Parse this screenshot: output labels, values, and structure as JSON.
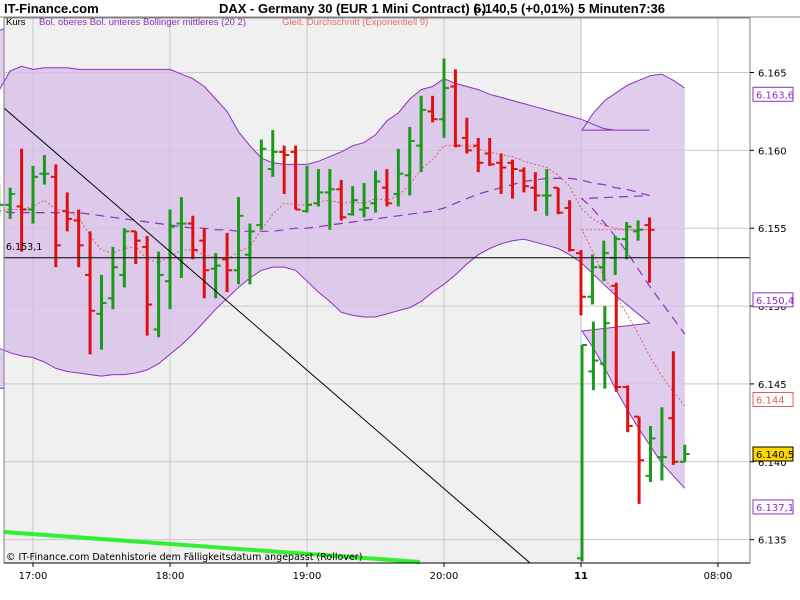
{
  "header": {
    "brand": "IT-Finance.com",
    "instrument": "DAX - Germany 30 (EUR 1 Mini Contract) (-)",
    "last": "6.140,5 (+0,01%)",
    "interval": "5 Minuten",
    "time": "7:36"
  },
  "legend": {
    "bollinger": "Bol. oberes Bol. unteres Bollinger mittleres (20 2)",
    "ema": "Gleit. Durchschnitt (Exponentiell 9)"
  },
  "kurs_label": "Kurs",
  "hline_label": "6.153,1",
  "footer_note": "© IT-Finance.com  Datenhistorie dem Fälligkeitsdatum angepasst (Rollover)",
  "colors": {
    "up": "#1a9a1a",
    "down": "#e01010",
    "band_fill": "#d8bfe8",
    "band_line": "#8e2fbe",
    "ema": "#e06060",
    "future_bg": "#ffffff",
    "plot_bg": "#f0f0f0",
    "green_line": "#33ee33"
  },
  "chart_data": {
    "type": "ohlc",
    "x_tick_labels": [
      "17:00",
      "18:00",
      "19:00",
      "20:00",
      "11",
      "08:00"
    ],
    "y_tick_labels": [
      "6.135",
      "6.140",
      "6.145",
      "6.150",
      "6.155",
      "6.160",
      "6.165"
    ],
    "ylim": [
      6133.5,
      6168.5
    ],
    "price_labels": [
      "6.163,6",
      "6.150,4",
      "6.144",
      "6.140,5",
      "6.137,1"
    ],
    "hline": 6153.1,
    "bars": [
      {
        "t": "16:35",
        "o": 6155.2,
        "h": 6158.9,
        "l": 6151.4,
        "c": 6157.1
      },
      {
        "t": "16:40",
        "o": 6157.1,
        "h": 6158.6,
        "l": 6155.9,
        "c": 6156.2
      },
      {
        "t": "16:45",
        "o": 6156.2,
        "h": 6157.8,
        "l": 6155.8,
        "c": 6156.5
      },
      {
        "t": "16:50",
        "o": 6156.5,
        "h": 6157.6,
        "l": 6155.6,
        "c": 6157.2
      },
      {
        "t": "16:55",
        "o": 6156.4,
        "h": 6160.1,
        "l": 6153.5,
        "c": 6156.2
      },
      {
        "t": "17:00",
        "o": 6156.2,
        "h": 6159.0,
        "l": 6155.3,
        "c": 6158.3
      },
      {
        "t": "17:05",
        "o": 6158.5,
        "h": 6159.7,
        "l": 6157.8,
        "c": 6158.5
      },
      {
        "t": "17:10",
        "o": 6158.3,
        "h": 6159.1,
        "l": 6152.5,
        "c": 6153.9
      },
      {
        "t": "17:15",
        "o": 6156.1,
        "h": 6157.3,
        "l": 6154.8,
        "c": 6155.6
      },
      {
        "t": "17:20",
        "o": 6155.5,
        "h": 6156.2,
        "l": 6152.5,
        "c": 6153.9
      },
      {
        "t": "17:25",
        "o": 6152.0,
        "h": 6154.8,
        "l": 6146.9,
        "c": 6149.7
      },
      {
        "t": "17:30",
        "o": 6149.5,
        "h": 6152.0,
        "l": 6147.2,
        "c": 6150.2
      },
      {
        "t": "17:35",
        "o": 6150.5,
        "h": 6153.8,
        "l": 6149.8,
        "c": 6152.5
      },
      {
        "t": "17:40",
        "o": 6152.0,
        "h": 6155.0,
        "l": 6151.2,
        "c": 6154.8
      },
      {
        "t": "17:45",
        "o": 6154.8,
        "h": 6154.8,
        "l": 6152.7,
        "c": 6154.2
      },
      {
        "t": "17:50",
        "o": 6153.8,
        "h": 6154.5,
        "l": 6148.1,
        "c": 6150.1
      },
      {
        "t": "17:55",
        "o": 6148.5,
        "h": 6153.5,
        "l": 6148.0,
        "c": 6152.0
      },
      {
        "t": "18:00",
        "o": 6151.6,
        "h": 6156.2,
        "l": 6149.8,
        "c": 6155.1
      },
      {
        "t": "18:05",
        "o": 6155.3,
        "h": 6157.0,
        "l": 6151.8,
        "c": 6155.3
      },
      {
        "t": "18:10",
        "o": 6155.3,
        "h": 6155.8,
        "l": 6153.0,
        "c": 6153.6
      },
      {
        "t": "18:15",
        "o": 6154.2,
        "h": 6155.0,
        "l": 6150.5,
        "c": 6152.3
      },
      {
        "t": "18:20",
        "o": 6152.4,
        "h": 6153.4,
        "l": 6150.5,
        "c": 6152.6
      },
      {
        "t": "18:25",
        "o": 6153.0,
        "h": 6154.7,
        "l": 6150.9,
        "c": 6152.3
      },
      {
        "t": "18:30",
        "o": 6152.3,
        "h": 6157.0,
        "l": 6151.4,
        "c": 6155.8
      },
      {
        "t": "18:35",
        "o": 6153.3,
        "h": 6155.3,
        "l": 6151.4,
        "c": 6154.8
      },
      {
        "t": "18:40",
        "o": 6155.2,
        "h": 6160.7,
        "l": 6154.9,
        "c": 6160.1
      },
      {
        "t": "18:45",
        "o": 6158.8,
        "h": 6161.3,
        "l": 6158.3,
        "c": 6159.9
      },
      {
        "t": "18:50",
        "o": 6159.9,
        "h": 6160.3,
        "l": 6157.2,
        "c": 6159.7
      },
      {
        "t": "18:55",
        "o": 6159.9,
        "h": 6160.3,
        "l": 6156.2,
        "c": 6156.2
      },
      {
        "t": "19:00",
        "o": 6156.1,
        "h": 6159.0,
        "l": 6156.0,
        "c": 6156.5
      },
      {
        "t": "19:05",
        "o": 6156.6,
        "h": 6158.8,
        "l": 6156.4,
        "c": 6157.3
      },
      {
        "t": "19:10",
        "o": 6157.3,
        "h": 6158.8,
        "l": 6154.9,
        "c": 6157.5
      },
      {
        "t": "19:15",
        "o": 6157.5,
        "h": 6158.1,
        "l": 6155.5,
        "c": 6155.7
      },
      {
        "t": "19:20",
        "o": 6155.9,
        "h": 6157.7,
        "l": 6155.8,
        "c": 6156.8
      },
      {
        "t": "19:25",
        "o": 6156.2,
        "h": 6157.9,
        "l": 6155.7,
        "c": 6156.3
      },
      {
        "t": "19:30",
        "o": 6156.6,
        "h": 6158.7,
        "l": 6156.0,
        "c": 6158.0
      },
      {
        "t": "19:35",
        "o": 6157.6,
        "h": 6158.8,
        "l": 6156.4,
        "c": 6156.6
      },
      {
        "t": "19:40",
        "o": 6157.2,
        "h": 6160.1,
        "l": 6156.4,
        "c": 6158.5
      },
      {
        "t": "19:45",
        "o": 6158.4,
        "h": 6161.5,
        "l": 6157.1,
        "c": 6160.6
      },
      {
        "t": "19:50",
        "o": 6160.3,
        "h": 6163.5,
        "l": 6158.6,
        "c": 6162.6
      },
      {
        "t": "19:55",
        "o": 6162.5,
        "h": 6163.5,
        "l": 6161.8,
        "c": 6162.0
      },
      {
        "t": "20:00",
        "o": 6162.0,
        "h": 6165.9,
        "l": 6160.8,
        "c": 6164.0
      },
      {
        "t": "20:05",
        "o": 6164.1,
        "h": 6165.2,
        "l": 6160.2,
        "c": 6160.3
      },
      {
        "t": "20:10",
        "o": 6160.8,
        "h": 6162.1,
        "l": 6159.8,
        "c": 6160.0
      },
      {
        "t": "20:15",
        "o": 6160.3,
        "h": 6160.8,
        "l": 6158.6,
        "c": 6159.2
      },
      {
        "t": "20:20",
        "o": 6159.8,
        "h": 6160.8,
        "l": 6159.0,
        "c": 6159.1
      },
      {
        "t": "20:25",
        "o": 6159.2,
        "h": 6159.8,
        "l": 6157.2,
        "c": 6158.9
      },
      {
        "t": "20:30",
        "o": 6159.2,
        "h": 6159.4,
        "l": 6156.9,
        "c": 6158.8
      },
      {
        "t": "20:35",
        "o": 6158.7,
        "h": 6158.9,
        "l": 6157.3,
        "c": 6157.7
      },
      {
        "t": "20:40",
        "o": 6157.6,
        "h": 6158.6,
        "l": 6156.1,
        "c": 6157.1
      },
      {
        "t": "20:45",
        "o": 6157.1,
        "h": 6158.8,
        "l": 6155.8,
        "c": 6157.1
      },
      {
        "t": "20:50",
        "o": 6157.6,
        "h": 6157.6,
        "l": 6155.9,
        "c": 6156.0
      },
      {
        "t": "20:55",
        "o": 6156.3,
        "h": 6156.8,
        "l": 6153.5,
        "c": 6153.6
      },
      {
        "t": "21:00",
        "o": 6153.4,
        "h": 6153.6,
        "l": 6149.4,
        "c": 6150.6
      },
      {
        "t": "21:05",
        "o": 6150.6,
        "h": 6153.3,
        "l": 6150.1,
        "c": 6152.5
      },
      {
        "t": "21:10",
        "o": 6152.5,
        "h": 6154.2,
        "l": 6151.6,
        "c": 6153.4
      },
      {
        "t": "21:15",
        "o": 6153.1,
        "h": 6154.5,
        "l": 6152.0,
        "c": 6154.3
      },
      {
        "t": "21:20",
        "o": 6154.3,
        "h": 6155.4,
        "l": 6153.0,
        "c": 6155.1
      },
      {
        "t": "21:25",
        "o": 6154.8,
        "h": 6155.5,
        "l": 6154.2,
        "c": 6154.9
      },
      {
        "t": "21:30",
        "o": 6155.2,
        "h": 6155.7,
        "l": 6151.5,
        "c": 6154.9
      },
      {
        "t": "08:00",
        "o": 6133.8,
        "h": 6147.5,
        "l": 6133.6,
        "c": 6147.5
      },
      {
        "t": "08:05",
        "o": 6145.8,
        "h": 6149.0,
        "l": 6144.6,
        "c": 6146.5
      },
      {
        "t": "08:10",
        "o": 6146.3,
        "h": 6150.0,
        "l": 6144.7,
        "c": 6148.9
      },
      {
        "t": "08:15",
        "o": 6151.3,
        "h": 6151.5,
        "l": 6144.5,
        "c": 6144.8
      },
      {
        "t": "08:20",
        "o": 6144.8,
        "h": 6144.9,
        "l": 6141.9,
        "c": 6142.3
      },
      {
        "t": "08:25",
        "o": 6142.9,
        "h": 6142.9,
        "l": 6137.3,
        "c": 6140.1
      },
      {
        "t": "08:30",
        "o": 6139.1,
        "h": 6142.3,
        "l": 6138.7,
        "c": 6141.5
      },
      {
        "t": "08:35",
        "o": 6140.3,
        "h": 6143.5,
        "l": 6138.8,
        "c": 6140.3
      },
      {
        "t": "08:40",
        "o": 6142.8,
        "h": 6147.1,
        "l": 6139.8,
        "c": 6140.0
      },
      {
        "t": "08:45",
        "o": 6140.0,
        "h": 6141.1,
        "l": 6140.0,
        "c": 6140.5
      }
    ],
    "bollinger": {
      "upper": [
        6167.3,
        6165.2,
        6163.8,
        6165.1,
        6165.4,
        6165.2,
        6165.3,
        6165.3,
        6165.3,
        6165.2,
        6165.2,
        6165.2,
        6165.2,
        6165.2,
        6165.2,
        6165.2,
        6165.2,
        6165.2,
        6164.9,
        6164.6,
        6164.1,
        6163.3,
        6162.5,
        6161.2,
        6160.3,
        6159.5,
        6159.2,
        6159.1,
        6159.1,
        6159.1,
        6159.3,
        6159.6,
        6159.9,
        6160.3,
        6160.5,
        6161.0,
        6161.9,
        6162.4,
        6163.3,
        6163.9,
        6164.1,
        6164.6,
        6164.3,
        6164.1,
        6163.9,
        6163.6,
        6163.4,
        6163.2,
        6163.0,
        6162.8,
        6162.6,
        6162.4,
        6162.2,
        6162.0,
        6161.7,
        6161.4,
        6161.3,
        6161.3,
        6161.3,
        6161.3,
        6161.3,
        6162.4,
        6163.2,
        6163.7,
        6164.2,
        6164.5,
        6164.8,
        6164.9,
        6164.5,
        6164.0,
        6163.6,
        6163.6
      ],
      "lower": [
        6145.0,
        6145.8,
        6147.3,
        6147.0,
        6146.8,
        6146.7,
        6146.4,
        6146.0,
        6145.8,
        6145.7,
        6145.6,
        6145.5,
        6145.6,
        6145.6,
        6145.7,
        6145.9,
        6146.3,
        6146.9,
        6147.5,
        6148.2,
        6149.0,
        6149.8,
        6150.5,
        6151.2,
        6151.8,
        6152.3,
        6152.5,
        6152.5,
        6152.3,
        6151.6,
        6150.9,
        6150.3,
        6149.6,
        6149.4,
        6149.3,
        6149.3,
        6149.5,
        6149.7,
        6149.9,
        6150.3,
        6150.9,
        6151.4,
        6152.0,
        6152.7,
        6153.3,
        6153.7,
        6154.0,
        6154.2,
        6154.3,
        6154.1,
        6153.9,
        6153.7,
        6153.3,
        6152.8,
        6152.1,
        6151.4,
        6150.7,
        6150.1,
        6149.5,
        6148.9,
        6148.4,
        6147.3,
        6146.0,
        6144.6,
        6143.3,
        6142.1,
        6141.0,
        6139.9,
        6139.1,
        6138.3,
        6137.6,
        6137.1
      ],
      "middle": [
        6156.2,
        6156.1,
        6156.1,
        6156.0,
        6156.0,
        6156.0,
        6156.0,
        6156.0,
        6156.0,
        6156.0,
        6155.9,
        6155.8,
        6155.7,
        6155.6,
        6155.5,
        6155.4,
        6155.3,
        6155.2,
        6155.1,
        6155.0,
        6155.0,
        6154.9,
        6154.9,
        6154.8,
        6154.8,
        6154.8,
        6154.8,
        6154.9,
        6155.0,
        6155.0,
        6155.1,
        6155.2,
        6155.3,
        6155.4,
        6155.5,
        6155.6,
        6155.7,
        6155.8,
        6155.9,
        6156.0,
        6156.1,
        6156.3,
        6156.6,
        6156.9,
        6157.2,
        6157.4,
        6157.6,
        6157.8,
        6158.0,
        6158.1,
        6158.2,
        6158.2,
        6158.2,
        6158.1,
        6157.9,
        6157.8,
        6157.6,
        6157.5,
        6157.3,
        6157.1,
        6156.9,
        6156.2,
        6155.3,
        6154.4,
        6153.4,
        6152.3,
        6151.2,
        6150.2,
        6149.2,
        6148.2,
        6147.3,
        6146.3
      ]
    },
    "ema9": [
      6155.8,
      6156.0,
      6156.1,
      6156.2,
      6156.2,
      6156.4,
      6156.8,
      6156.2,
      6156.1,
      6155.7,
      6154.5,
      6153.6,
      6153.4,
      6153.7,
      6153.8,
      6153.0,
      6152.8,
      6153.2,
      6153.6,
      6153.6,
      6153.3,
      6153.1,
      6153.0,
      6153.5,
      6153.8,
      6154.9,
      6155.9,
      6156.6,
      6156.5,
      6156.5,
      6156.7,
      6156.8,
      6156.6,
      6156.7,
      6156.6,
      6156.9,
      6156.8,
      6157.1,
      6157.8,
      6158.8,
      6159.4,
      6160.3,
      6160.3,
      6160.3,
      6160.1,
      6159.9,
      6159.7,
      6159.6,
      6159.3,
      6159.1,
      6158.9,
      6158.4,
      6157.7,
      6156.3,
      6155.6,
      6155.2,
      6155.0,
      6154.9,
      6154.9,
      6154.9,
      6154.9,
      6153.4,
      6151.8,
      6150.6,
      6149.4,
      6148.1,
      6146.7,
      6145.5,
      6144.5,
      6143.6,
      6142.7,
      6142.1
    ]
  }
}
